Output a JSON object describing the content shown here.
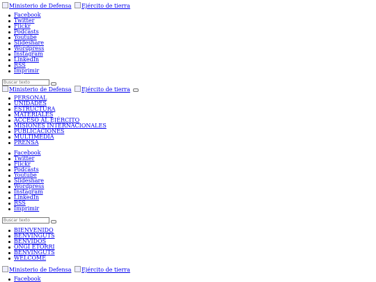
{
  "logos": {
    "ministerio_alt": "Ministerio de Defensa",
    "ejercito_alt": "Ejército de tierra"
  },
  "social": [
    "Facebook",
    "Twitter",
    "Flickr",
    "Podcasts",
    "Youtube",
    "Slideshare",
    "Wordpress",
    "Instagram",
    "LinkedIn",
    "RSS",
    "Imprimir"
  ],
  "search": {
    "placeholder": "Buscar texto"
  },
  "main_nav": [
    "PERSONAL",
    "UNIDADES",
    "ESTRUCTURA",
    "MATERIALES",
    "ACCESO AL EJÉRCITO",
    "MISIONES INTERNACIONALES",
    "PUBLICACIONES",
    "MULTIMEDIA",
    "PRENSA"
  ],
  "languages": [
    "BIENVENIDO",
    "BENVINGUTS",
    "BENVIDOS",
    "ONGI ETORRI",
    "BENVINGUTS",
    "WELCOME"
  ]
}
